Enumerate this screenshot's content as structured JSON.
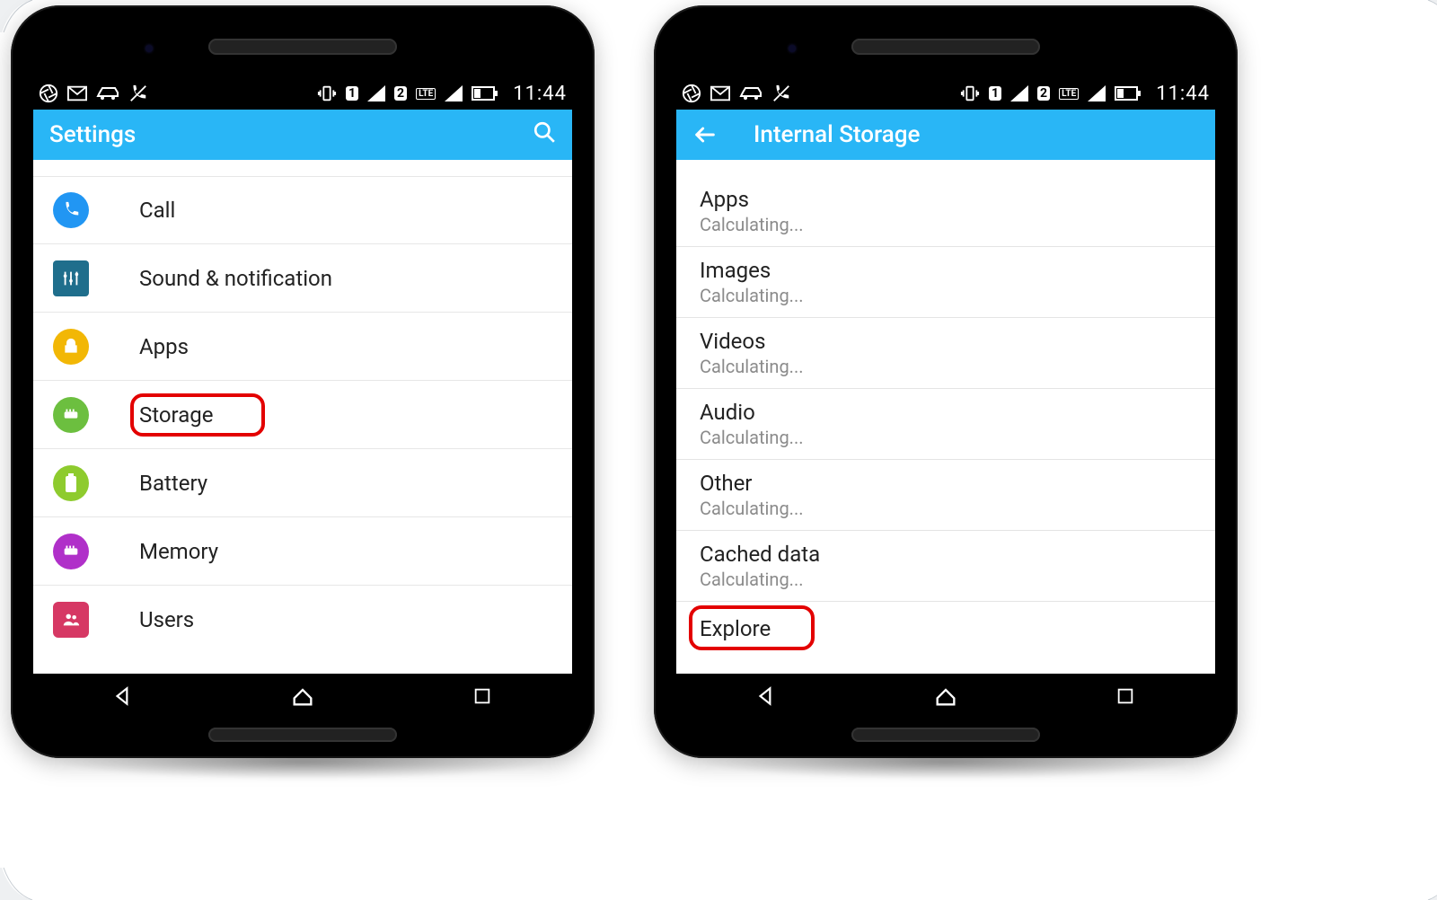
{
  "status": {
    "time": "11:44"
  },
  "left": {
    "appbar": {
      "title": "Settings"
    },
    "items": [
      {
        "label": "Call"
      },
      {
        "label": "Sound & notification"
      },
      {
        "label": "Apps"
      },
      {
        "label": "Storage"
      },
      {
        "label": "Battery"
      },
      {
        "label": "Memory"
      },
      {
        "label": "Users"
      }
    ]
  },
  "right": {
    "appbar": {
      "title": "Internal Storage"
    },
    "items": [
      {
        "title": "Apps",
        "sub": "Calculating..."
      },
      {
        "title": "Images",
        "sub": "Calculating..."
      },
      {
        "title": "Videos",
        "sub": "Calculating..."
      },
      {
        "title": "Audio",
        "sub": "Calculating..."
      },
      {
        "title": "Other",
        "sub": "Calculating..."
      },
      {
        "title": "Cached data",
        "sub": "Calculating..."
      },
      {
        "title": "Explore",
        "sub": ""
      }
    ]
  }
}
